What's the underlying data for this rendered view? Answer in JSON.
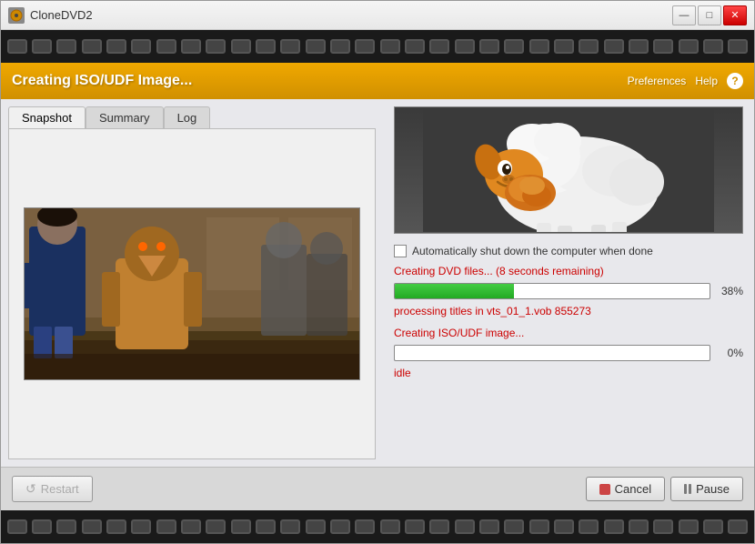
{
  "window": {
    "title": "CloneDVD2",
    "icon": "dvd-icon",
    "controls": {
      "minimize": "—",
      "maximize": "□",
      "close": "✕"
    }
  },
  "film_strip": {
    "holes_count": 30
  },
  "header": {
    "title": "Creating ISO/UDF Image...",
    "preferences_label": "Preferences",
    "help_label": "Help",
    "help_button": "?"
  },
  "tabs": [
    {
      "id": "snapshot",
      "label": "Snapshot",
      "active": true
    },
    {
      "id": "summary",
      "label": "Summary",
      "active": false
    },
    {
      "id": "log",
      "label": "Log",
      "active": false
    }
  ],
  "progress": {
    "checkbox_label": "Automatically shut down the computer when done",
    "task1_label": "Creating DVD files... (8 seconds remaining)",
    "task1_percent": "38%",
    "task1_fill_width": "38%",
    "task1_info": "processing titles in vts_01_1.vob 855273",
    "task2_label": "Creating ISO/UDF image...",
    "task2_percent": "0%",
    "task2_fill_width": "0%",
    "status": "idle"
  },
  "footer": {
    "restart_label": "Restart",
    "cancel_label": "Cancel",
    "pause_label": "Pause"
  }
}
